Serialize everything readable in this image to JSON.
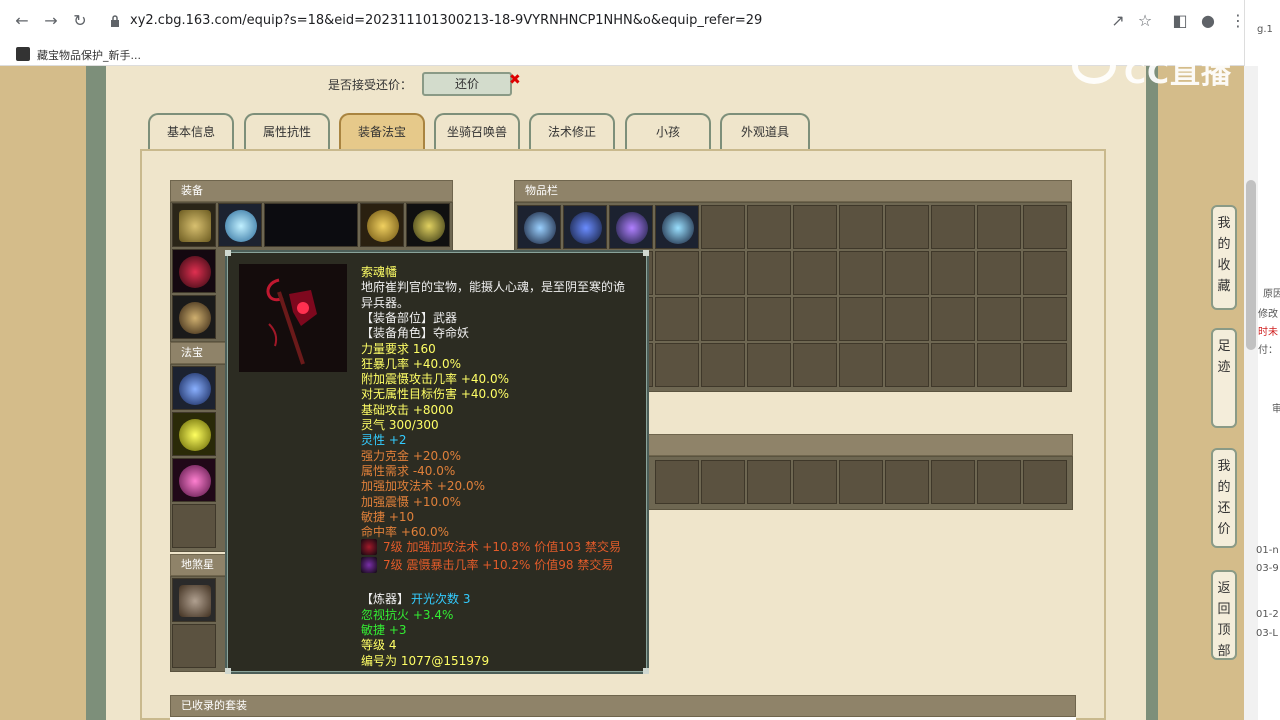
{
  "browser": {
    "url": "xy2.cbg.163.com/equip?s=18&eid=202311101300213-18-9VYRNHNCP1NHN&o&equip_refer=29",
    "bookmark": "藏宝物品保护_新手..."
  },
  "watermark": "CC直播",
  "offer": {
    "label": "是否接受还价：",
    "button": "还价"
  },
  "tabs": [
    "基本信息",
    "属性抗性",
    "装备法宝",
    "坐骑召唤兽",
    "法术修正",
    "小孩",
    "外观道具"
  ],
  "sections": {
    "equipment": "装备",
    "fabao": "法宝",
    "disha": "地煞星",
    "inventory": "物品栏",
    "collected_sets": "已收录的套装"
  },
  "tooltip": {
    "name": "索魂幡",
    "desc1": "地府崔判官的宝物，能摄人心魂，是至阴至寒的诡",
    "desc2": "异兵器。",
    "slot": "【装备部位】武器",
    "role": "【装备角色】夺命妖",
    "stats": [
      {
        "text": "力量要求 160",
        "color": "#ffff66"
      },
      {
        "text": "狂暴几率 +40.0%",
        "color": "#ffff66"
      },
      {
        "text": "附加震慑攻击几率 +40.0%",
        "color": "#ffff66"
      },
      {
        "text": "对无属性目标伤害 +40.0%",
        "color": "#ffff66"
      },
      {
        "text": "基础攻击 +8000",
        "color": "#ffff66"
      },
      {
        "text": "灵气 300/300",
        "color": "#ffff66"
      },
      {
        "text": "灵性 +2",
        "color": "#33ccff"
      },
      {
        "text": "强力克金 +20.0%",
        "color": "#e0803a"
      },
      {
        "text": "属性需求 -40.0%",
        "color": "#e0803a"
      },
      {
        "text": "加强加攻法术 +20.0%",
        "color": "#e0803a"
      },
      {
        "text": "加强震慑 +10.0%",
        "color": "#e0803a"
      },
      {
        "text": "敏捷 +10",
        "color": "#e0803a"
      },
      {
        "text": "命中率 +60.0%",
        "color": "#e0803a"
      }
    ],
    "gems": [
      {
        "text": "7级 加强加攻法术 +10.8% 价值103 禁交易",
        "color": "#a21a2a"
      },
      {
        "text": "7级 震慑暴击几率 +10.2% 价值98 禁交易",
        "color": "#7a2fa8"
      }
    ],
    "refine_label": "【炼器】",
    "refine_value": "开光次数 3",
    "refine_stats": [
      {
        "text": "忽视抗火 +3.4%",
        "color": "#33ee33"
      },
      {
        "text": "敏捷 +3",
        "color": "#33ee33"
      },
      {
        "text": "等级 4",
        "color": "#ffff66"
      },
      {
        "text": "编号为 1077@151979",
        "color": "#ffff66"
      }
    ]
  },
  "side_buttons": [
    {
      "label": "我的收藏",
      "name": "my-favorites-button"
    },
    {
      "label": "足迹",
      "name": "history-button"
    },
    {
      "label": "我的还价",
      "name": "my-offers-button"
    },
    {
      "label": "返回顶部",
      "name": "back-to-top-button"
    }
  ],
  "sliver_text": [
    "g.1",
    "原因",
    "修改",
    "时未",
    "付：",
    "审",
    "01-n",
    "03-9",
    "01-2",
    "03-L"
  ]
}
